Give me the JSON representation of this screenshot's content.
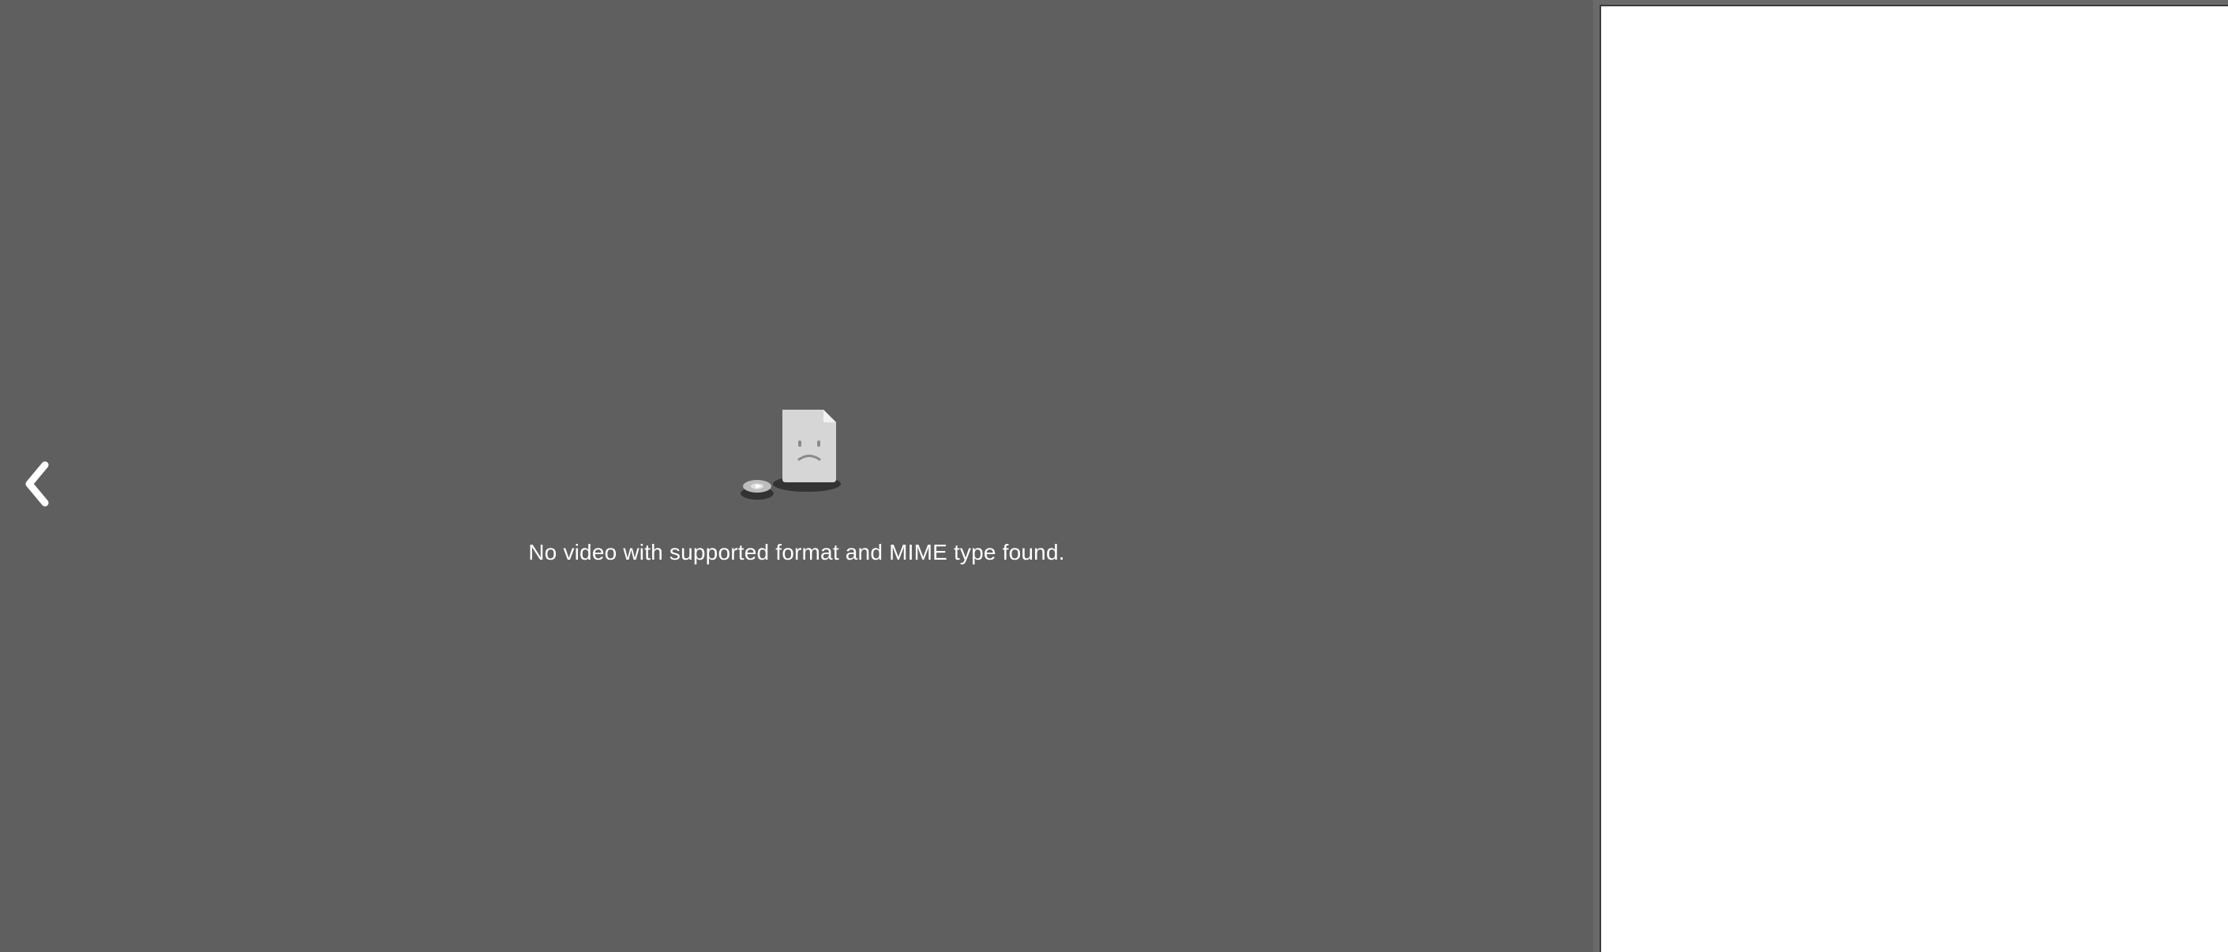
{
  "player": {
    "background_color": "#5f5f5f",
    "error_message": "No video with supported format and MIME type found.",
    "error_icon": "sad-document-icon",
    "prev_icon": "chevron-left-icon"
  },
  "side_panel": {
    "background_color": "#ffffff"
  }
}
